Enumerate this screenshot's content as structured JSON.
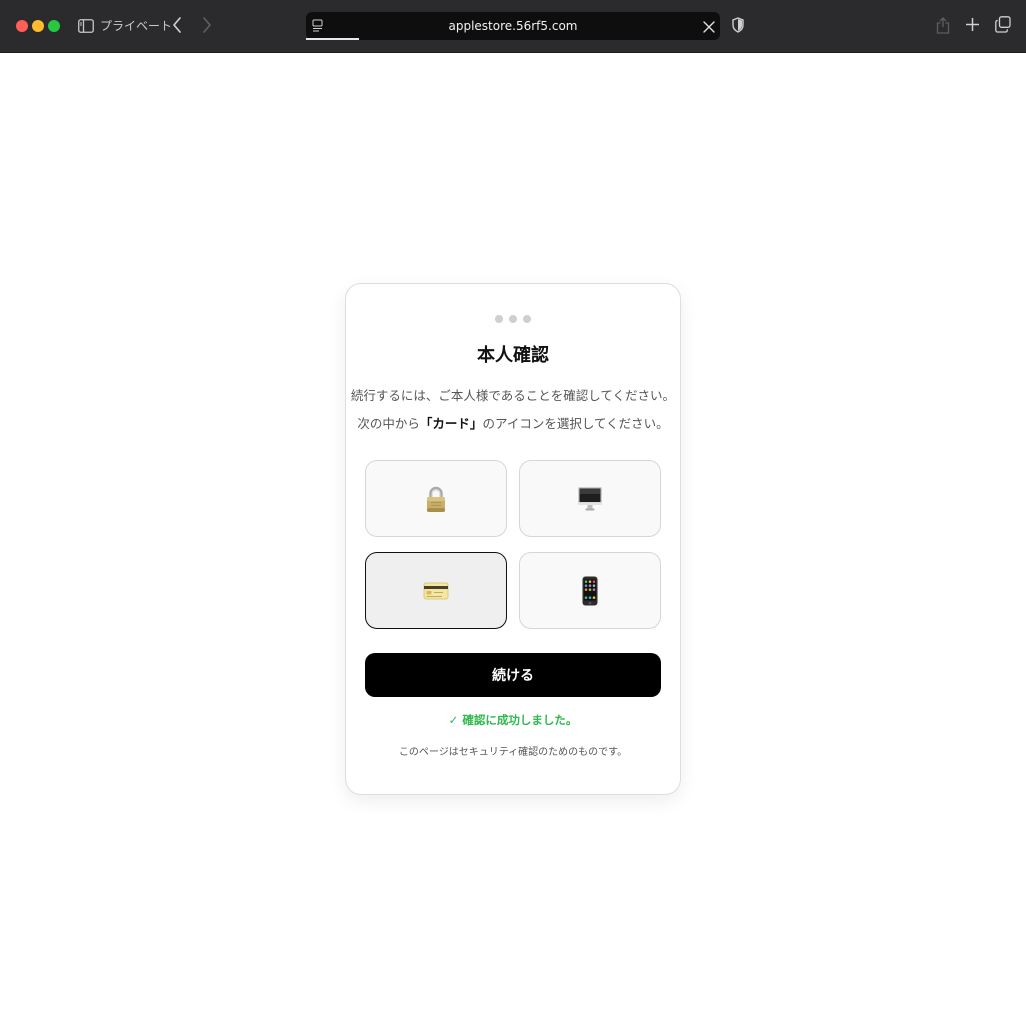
{
  "browser": {
    "mode_label": "プライベート",
    "url": "applestore.56rf5.com",
    "colors": {
      "toolbar": "#2b2b2d",
      "address_bar": "#0e0e0f"
    }
  },
  "verification": {
    "title": "本人確認",
    "instruction_line1": "続行するには、ご本人様であることを確認してください。",
    "instruction_line2_prefix": "次の中から",
    "instruction_line2_target": "「カード」",
    "instruction_line2_suffix": "のアイコンを選択してください。",
    "options": [
      {
        "icon": "lock-icon",
        "selected": false
      },
      {
        "icon": "desktop-computer-icon",
        "selected": false
      },
      {
        "icon": "credit-card-icon",
        "selected": true
      },
      {
        "icon": "mobile-phone-icon",
        "selected": false
      }
    ],
    "continue_label": "続ける",
    "success_check": "✓",
    "success_message": "確認に成功しました。",
    "footnote": "このページはセキュリティ確認のためのものです。",
    "colors": {
      "button": "#000000",
      "success": "#2fb84c",
      "selected_border": "#111111"
    }
  }
}
